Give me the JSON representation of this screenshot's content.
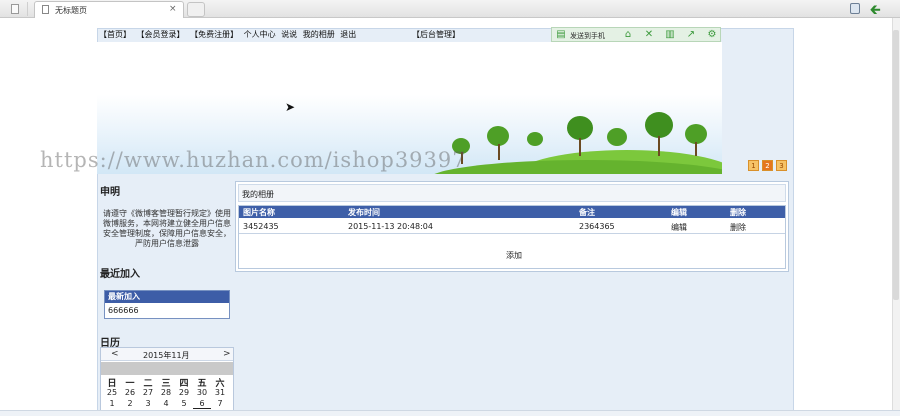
{
  "browser": {
    "tab_title": "无标题页",
    "tab_close": "×",
    "back_arrow": "🡰",
    "icons": [
      "page-icon",
      "new-tab-icon",
      "bookmark-icon",
      "back-icon"
    ]
  },
  "nav": {
    "items": [
      "【首页】",
      "【会员登录】",
      "【免费注册】",
      "个人中心",
      "说说",
      "我的相册",
      "退出"
    ],
    "admin": "【后台管理】"
  },
  "share_bar": {
    "send_label": "发送到手机",
    "icons": [
      "send-phone-icon",
      "cloud-icon",
      "expand-icon",
      "save-icon",
      "share-icon",
      "settings-icon"
    ]
  },
  "watermark": "https://www.huzhan.com/ishop39397",
  "pager": [
    "1",
    "2",
    "3"
  ],
  "sidebar": {
    "declare_title": "申明",
    "declare_text": "请遵守《微博客管理暂行规定》使用微博服务，本网将建立健全用户信息安全管理制度，保障用户信息安全，严防用户信息泄露",
    "recent_title": "最近加入",
    "recent_box_head": "最新加入",
    "recent_item": "666666",
    "calendar_title": "日历",
    "calendar": {
      "prev": "<",
      "month": "2015年11月",
      "next": ">",
      "weekdays": [
        "日",
        "一",
        "二",
        "三",
        "四",
        "五",
        "六"
      ],
      "row1": [
        "25",
        "26",
        "27",
        "28",
        "29",
        "30",
        "31"
      ],
      "row2": [
        "1",
        "2",
        "3",
        "4",
        "5",
        "6",
        "7"
      ],
      "today": "6"
    }
  },
  "album": {
    "title": "我的相册",
    "columns": [
      "图片名称",
      "发布时间",
      "备注",
      "编辑",
      "删除"
    ],
    "rows": [
      [
        "3452435",
        "2015-11-13 20:48:04",
        "2364365",
        "编辑",
        "删除"
      ]
    ],
    "add_label": "添加"
  },
  "colors": {
    "table_header": "#3e5fa8",
    "container_bg": "#e6eef7",
    "pager_active": "#e5761f",
    "grass": "#65b32e"
  }
}
